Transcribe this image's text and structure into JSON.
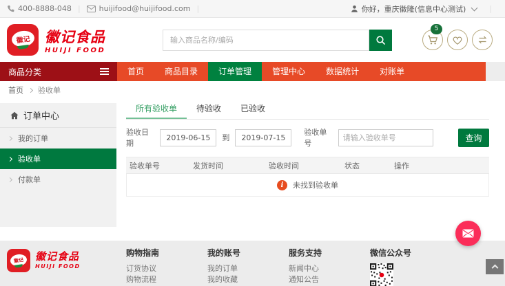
{
  "topbar": {
    "phone": "400-8888-048",
    "email": "huijifood@huijifood.com",
    "greeting": "你好，重庆徽隆(信息中心测试)"
  },
  "header": {
    "logo_badge": "徽记",
    "logo_title": "徽记食品",
    "logo_subtitle": "HUIJI FOOD",
    "search_placeholder": "输入商品名称/编码",
    "cart_badge": "5"
  },
  "nav": {
    "category_label": "商品分类",
    "items": [
      {
        "label": "首页",
        "active": false
      },
      {
        "label": "商品目录",
        "active": false
      },
      {
        "label": "订单管理",
        "active": true
      },
      {
        "label": "管理中心",
        "active": false
      },
      {
        "label": "数据统计",
        "active": false
      },
      {
        "label": "对账单",
        "active": false
      }
    ]
  },
  "breadcrumb": {
    "home": "首页",
    "current": "验收单"
  },
  "sidebar": {
    "title": "订单中心",
    "items": [
      {
        "label": "我的订单",
        "active": false
      },
      {
        "label": "验收单",
        "active": true
      },
      {
        "label": "付款单",
        "active": false
      }
    ]
  },
  "main": {
    "tabs": [
      {
        "label": "所有验收单",
        "active": true
      },
      {
        "label": "待验收",
        "active": false
      },
      {
        "label": "已验收",
        "active": false
      }
    ],
    "filters": {
      "date_label": "验收日期",
      "date_from": "2019-06-15",
      "to_label": "到",
      "date_to": "2019-07-15",
      "order_label": "验收单号",
      "order_placeholder": "请输入验收单号",
      "search_button": "查询"
    },
    "table": {
      "headers": [
        "验收单号",
        "发货时间",
        "验收时间",
        "状态",
        "操作"
      ],
      "empty_text": "未找到验收单"
    }
  },
  "footer": {
    "columns": [
      {
        "title": "购物指南",
        "links": [
          "订货协议",
          "购物流程"
        ]
      },
      {
        "title": "我的账号",
        "links": [
          "我的订单",
          "我的收藏"
        ]
      },
      {
        "title": "服务支持",
        "links": [
          "新闻中心",
          "通知公告"
        ]
      },
      {
        "title": "微信公众号",
        "links": []
      }
    ]
  },
  "colors": {
    "brand_red": "#e60012",
    "nav_orange": "#e74a27",
    "nav_dark_red": "#9d1016",
    "green": "#00793e",
    "active_green": "#00813f",
    "tab_green": "#37a065",
    "badge_green": "#17713a",
    "icon_tan": "#a4966c",
    "info_orange": "#e74c1f",
    "fab_pink": "#fb2d59",
    "footer_bg": "#ececec"
  }
}
